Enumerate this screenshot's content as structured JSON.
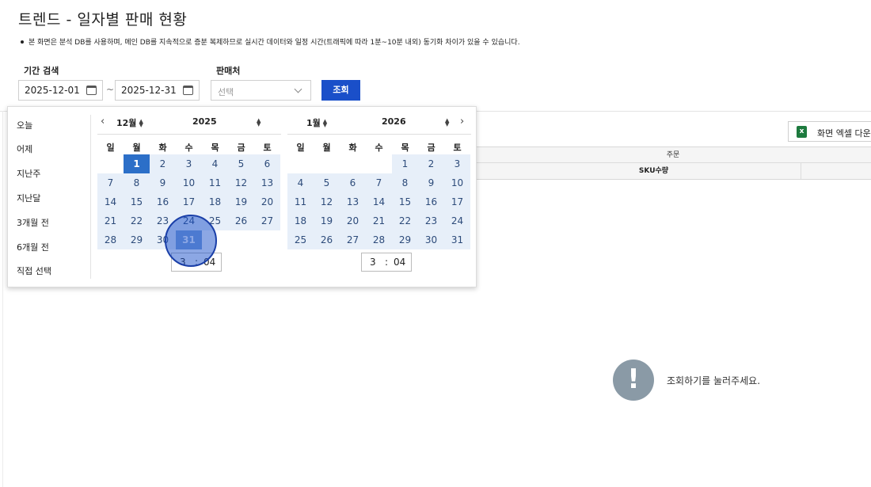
{
  "page": {
    "title": "트렌드 - 일자별 판매 현황",
    "notice": "본 화면은 분석 DB를 사용하며, 메인 DB를 지속적으로 증분 복제하므로 실시간 데이터와 일정 시간(트래픽에 따라 1분~10분 내외) 동기화 차이가 있을 수 있습니다."
  },
  "filters": {
    "period_label": "기간 검색",
    "start_date": "2025-12-01",
    "end_date": "2025-12-31",
    "separator": "~",
    "seller_label": "판매처",
    "seller_placeholder": "선택",
    "search_button": "조회"
  },
  "toolbar": {
    "excel_button": "화면 엑셀 다운로드",
    "excel_icon_glyph": "x"
  },
  "grid": {
    "group_header": "주문",
    "column_sku": "SKU수량"
  },
  "empty_state": {
    "icon": "!",
    "message": "조회하기를 눌러주세요."
  },
  "picker": {
    "ranges": [
      "오늘",
      "어제",
      "지난주",
      "지난달",
      "3개월 전",
      "6개월 전",
      "직접 선택"
    ],
    "weekdays": [
      "일",
      "월",
      "화",
      "수",
      "목",
      "금",
      "토"
    ],
    "left": {
      "month": "12월",
      "year": "2025",
      "first_weekday": 1,
      "days": 31,
      "time_hour": "3",
      "time_minute": "04"
    },
    "right": {
      "month": "1월",
      "year": "2026",
      "first_weekday": 4,
      "days": 31,
      "time_hour": "3",
      "time_minute": "04"
    },
    "selected_start": 1,
    "selected_end": 31,
    "time_separator": ":"
  },
  "colors": {
    "primary": "#1a4fc9",
    "range_fill": "#e7eff9",
    "selected_day": "#2c6fc8",
    "empty_icon": "#8a9aa6"
  }
}
